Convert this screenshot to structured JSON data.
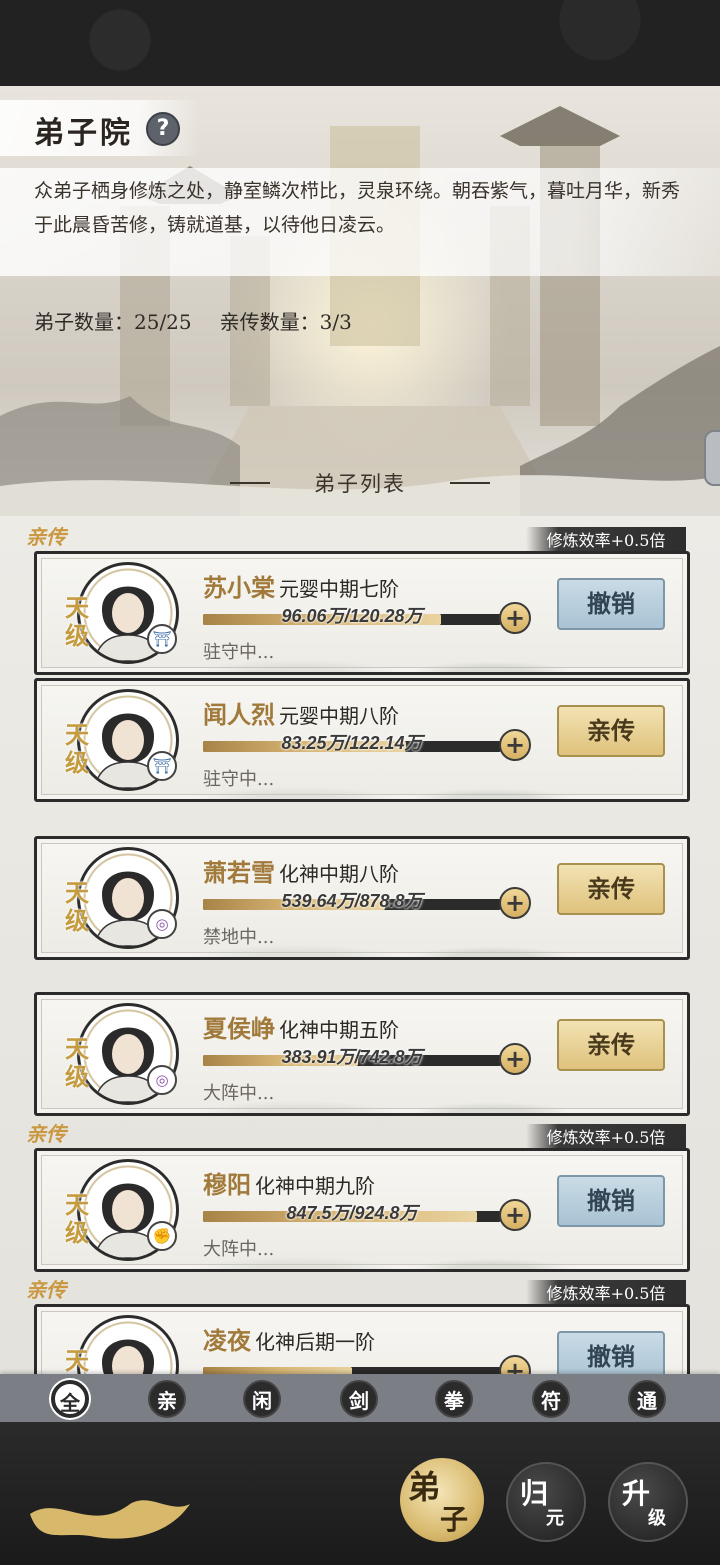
{
  "header": {
    "title": "弟子院",
    "help_icon": "?",
    "description": "众弟子栖身修炼之处，静室鳞次栉比，灵泉环绕。朝吞紫气，暮吐月华，新秀于此晨昏苦修，铸就道基，以待他日凌云。",
    "disciple_count": "弟子数量：25/25",
    "inner_count": "亲传数量：3/3",
    "list_title": "弟子列表"
  },
  "disciples": [
    {
      "name": "苏小棠",
      "realm": "元婴中期七阶",
      "progress": "96.06万/120.28万",
      "progress_ratio": 0.8,
      "status": "驻守中...",
      "rank": "天级",
      "element_icon": "pagoda-icon",
      "element_color": "#3f6fa8",
      "action": "撤销",
      "inner": true,
      "inner_tag": "亲传",
      "bonus": "修炼效率+0.5倍"
    },
    {
      "name": "闻人烈",
      "realm": "元婴中期八阶",
      "progress": "83.25万/122.14万",
      "progress_ratio": 0.68,
      "status": "驻守中...",
      "rank": "天级",
      "element_icon": "pagoda-icon",
      "element_color": "#3f6fa8",
      "action": "亲传",
      "inner": false
    },
    {
      "name": "萧若雪",
      "realm": "化神中期八阶",
      "progress": "539.64万/878.8万",
      "progress_ratio": 0.61,
      "status": "禁地中...",
      "rank": "天级",
      "element_icon": "swirl-icon",
      "element_color": "#8a4fa8",
      "action": "亲传",
      "inner": false
    },
    {
      "name": "夏侯峥",
      "realm": "化神中期五阶",
      "progress": "383.91万/742.8万",
      "progress_ratio": 0.52,
      "status": "大阵中...",
      "rank": "天级",
      "element_icon": "swirl-icon",
      "element_color": "#8a4fa8",
      "action": "亲传",
      "inner": false
    },
    {
      "name": "穆阳",
      "realm": "化神中期九阶",
      "progress": "847.5万/924.8万",
      "progress_ratio": 0.92,
      "status": "大阵中...",
      "rank": "天级",
      "element_icon": "fist-icon",
      "element_color": "#b8464a",
      "action": "撤销",
      "inner": true,
      "inner_tag": "亲传",
      "bonus": "修炼效率+0.5倍"
    },
    {
      "name": "凌夜",
      "realm": "化神后期一阶",
      "progress": "",
      "progress_ratio": 0.5,
      "status": "",
      "rank": "天级",
      "element_icon": "",
      "element_color": "#3f6fa8",
      "action": "撤销",
      "inner": true,
      "inner_tag": "亲传",
      "bonus": "修炼效率+0.5倍"
    }
  ],
  "filter_tabs": [
    "全",
    "亲",
    "闲",
    "剑",
    "拳",
    "符",
    "通"
  ],
  "bottom_nav": [
    {
      "top": "弟",
      "bottom": "子",
      "active": true
    },
    {
      "top": "归",
      "bottom": "元",
      "active": false
    },
    {
      "top": "升",
      "bottom": "级",
      "active": false
    }
  ]
}
